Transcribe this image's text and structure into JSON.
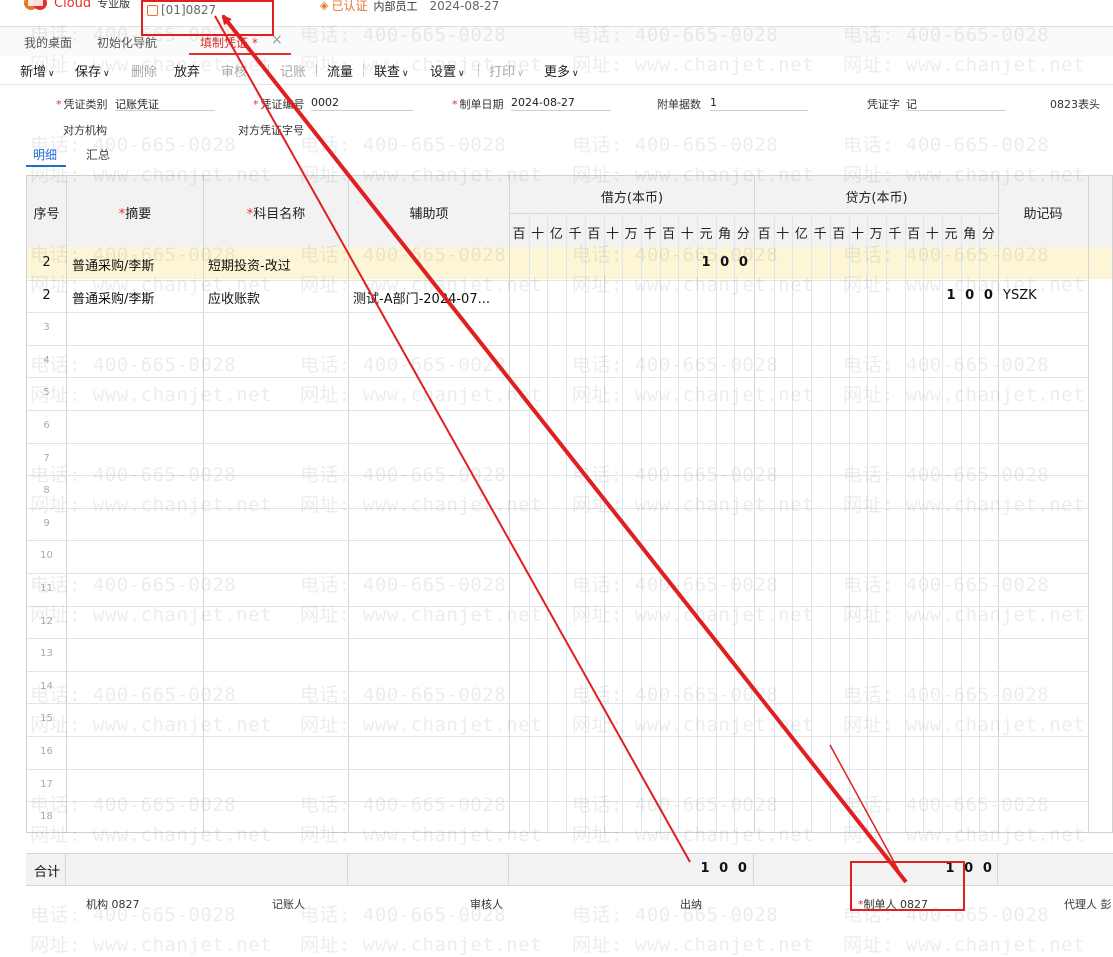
{
  "app": {
    "brand_name": "Cloud",
    "edition": "专业版",
    "account": "[01]0827",
    "cert_status": "已认证",
    "user_role": "内部员工",
    "date": "2024-08-27"
  },
  "tabs": [
    {
      "label": "我的桌面"
    },
    {
      "label": "初始化导航"
    },
    {
      "label": "填制凭证 *"
    }
  ],
  "toolbar": {
    "new": "新增",
    "save": "保存",
    "delete": "删除",
    "abandon": "放弃",
    "audit": "审核",
    "post": "记账",
    "flow": "流量",
    "link": "联查",
    "settings": "设置",
    "print": "打印",
    "more": "更多"
  },
  "form": {
    "voucher_type_label": "凭证类别",
    "voucher_type": "记账凭证",
    "voucher_no_label": "凭证编号",
    "voucher_no": "0002",
    "date_label": "制单日期",
    "date": "2024-08-27",
    "attachments_label": "附单据数",
    "attachments": "1",
    "voucher_word_label": "凭证字",
    "voucher_word": "记",
    "template": "0823表头",
    "counterparty_org_label": "对方机构",
    "counterparty_voucher_label": "对方凭证字号"
  },
  "subtabs": {
    "detail": "明细",
    "summary": "汇总"
  },
  "grid": {
    "headers": {
      "seq": "序号",
      "summary": "摘要",
      "account": "科目名称",
      "aux": "辅助项",
      "debit": "借方(本币)",
      "credit": "贷方(本币)",
      "memo": "助记码"
    },
    "digit_labels": [
      "百",
      "十",
      "亿",
      "千",
      "百",
      "十",
      "万",
      "千",
      "百",
      "十",
      "元",
      "角",
      "分"
    ],
    "rows": [
      {
        "seq": "2",
        "summary": "普通采购/李斯",
        "account": "短期投资-改过",
        "aux": "",
        "debit": [
          "1",
          "0",
          "0"
        ],
        "credit": [],
        "memo": ""
      },
      {
        "seq": "2",
        "summary": "普通采购/李斯",
        "account": "应收账款",
        "aux": "测试-A部门-2024-07...",
        "debit": [],
        "credit": [
          "1",
          "0",
          "0"
        ],
        "memo": "YSZK"
      }
    ],
    "empty_rows": [
      "3",
      "4",
      "5",
      "6",
      "7",
      "8",
      "9",
      "10",
      "11",
      "12",
      "13",
      "14",
      "15",
      "16",
      "17",
      "18"
    ]
  },
  "totals": {
    "label": "合计",
    "debit": [
      "1",
      "0",
      "0"
    ],
    "credit": [
      "1",
      "0",
      "0"
    ]
  },
  "footer": {
    "org_label": "机构",
    "org": "0827",
    "bookkeeper_label": "记账人",
    "auditor_label": "审核人",
    "cashier_label": "出纳",
    "creator_label": "制单人",
    "creator": "0827",
    "agent_label": "代理人 彭"
  },
  "watermark": {
    "phone": "电话: 400-665-0028",
    "site": "网址: www.chanjet.net"
  },
  "colors": {
    "brand_red": "#e0312e",
    "active_blue": "#1f6fd1",
    "highlight_row": "#fdf6d6",
    "annotation_red": "#e02020"
  }
}
